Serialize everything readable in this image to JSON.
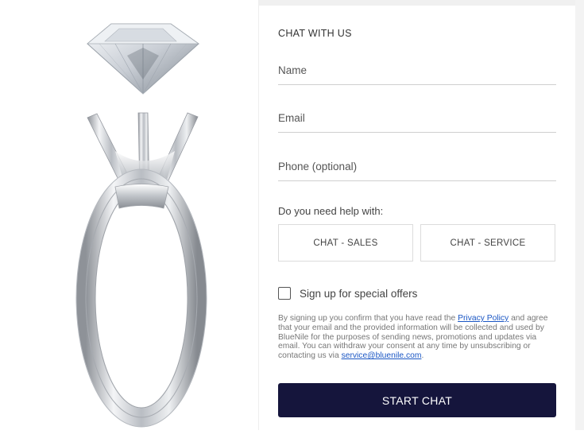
{
  "form": {
    "title": "CHAT WITH US",
    "name_placeholder": "Name",
    "email_placeholder": "Email",
    "phone_placeholder": "Phone (optional)",
    "help_label": "Do you need help with:",
    "options": [
      "CHAT - SALES",
      "CHAT - SERVICE"
    ],
    "signup_label": "Sign up for special offers",
    "signup_checked": false,
    "legal_text_1": "By signing up you confirm that you have read the ",
    "privacy_link": "Privacy Policy",
    "legal_text_2": " and agree that your email and the provided information will be collected and used by BlueNile for the purposes of sending news, promotions and updates via email. You can withdraw your consent at any time by unsubscribing or contacting us via ",
    "service_email": "service@bluenile.com",
    "legal_text_3": ".",
    "start_label": "START CHAT"
  },
  "colors": {
    "start_button": "#15153c",
    "link": "#1a56c4"
  },
  "image": {
    "icon": "diamond-ring-image"
  }
}
